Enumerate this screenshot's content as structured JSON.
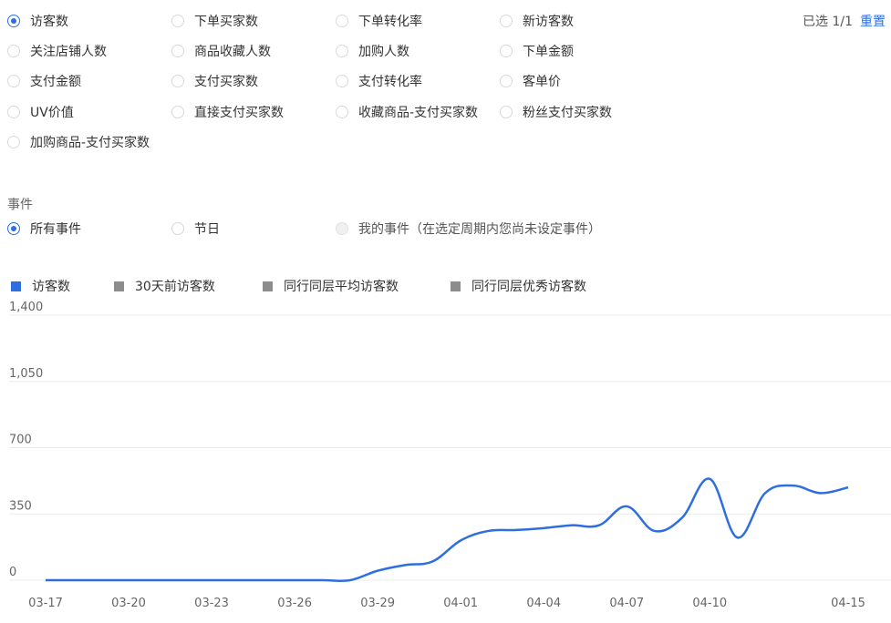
{
  "metrics": {
    "options": [
      {
        "label": "访客数",
        "checked": true
      },
      {
        "label": "下单买家数",
        "checked": false
      },
      {
        "label": "下单转化率",
        "checked": false
      },
      {
        "label": "新访客数",
        "checked": false
      },
      {
        "label": "关注店铺人数",
        "checked": false
      },
      {
        "label": "商品收藏人数",
        "checked": false
      },
      {
        "label": "加购人数",
        "checked": false
      },
      {
        "label": "下单金额",
        "checked": false
      },
      {
        "label": "支付金额",
        "checked": false
      },
      {
        "label": "支付买家数",
        "checked": false
      },
      {
        "label": "支付转化率",
        "checked": false
      },
      {
        "label": "客单价",
        "checked": false
      },
      {
        "label": "UV价值",
        "checked": false
      },
      {
        "label": "直接支付买家数",
        "checked": false
      },
      {
        "label": "收藏商品-支付买家数",
        "checked": false
      },
      {
        "label": "粉丝支付买家数",
        "checked": false
      },
      {
        "label": "加购商品-支付买家数",
        "checked": false
      }
    ],
    "selected_count": "已选 1/1",
    "reset_label": "重置"
  },
  "events": {
    "title": "事件",
    "options": [
      {
        "label": "所有事件",
        "checked": true,
        "disabled": false
      },
      {
        "label": "节日",
        "checked": false,
        "disabled": false
      },
      {
        "label": "我的事件（在选定周期内您尚未设定事件）",
        "checked": false,
        "disabled": true
      }
    ]
  },
  "legend": [
    {
      "label": "访客数",
      "color": "#2f6ee0"
    },
    {
      "label": "30天前访客数",
      "color": "#8c8c8c"
    },
    {
      "label": "同行同层平均访客数",
      "color": "#8c8c8c"
    },
    {
      "label": "同行同层优秀访客数",
      "color": "#8c8c8c"
    }
  ],
  "chart_data": {
    "type": "line",
    "x_ticks": [
      "03-17",
      "03-20",
      "03-23",
      "03-26",
      "03-29",
      "04-01",
      "04-04",
      "04-07",
      "04-10",
      "04-15"
    ],
    "y_ticks": [
      "1,400",
      "1,050",
      "700",
      "350",
      "0"
    ],
    "ylim": [
      0,
      1400
    ],
    "grid": true,
    "series": [
      {
        "name": "访客数",
        "color": "#2f6ee0",
        "x": [
          "03-17",
          "03-18",
          "03-19",
          "03-20",
          "03-21",
          "03-22",
          "03-23",
          "03-24",
          "03-25",
          "03-26",
          "03-27",
          "03-28",
          "03-29",
          "03-30",
          "03-31",
          "04-01",
          "04-02",
          "04-03",
          "04-04",
          "04-05",
          "04-06",
          "04-07",
          "04-08",
          "04-09",
          "04-10",
          "04-11",
          "04-12",
          "04-13",
          "04-14",
          "04-15"
        ],
        "values": [
          0,
          0,
          0,
          0,
          0,
          0,
          0,
          0,
          0,
          0,
          0,
          0,
          50,
          80,
          100,
          210,
          260,
          265,
          275,
          290,
          290,
          390,
          260,
          330,
          535,
          225,
          460,
          500,
          460,
          490
        ]
      }
    ]
  }
}
